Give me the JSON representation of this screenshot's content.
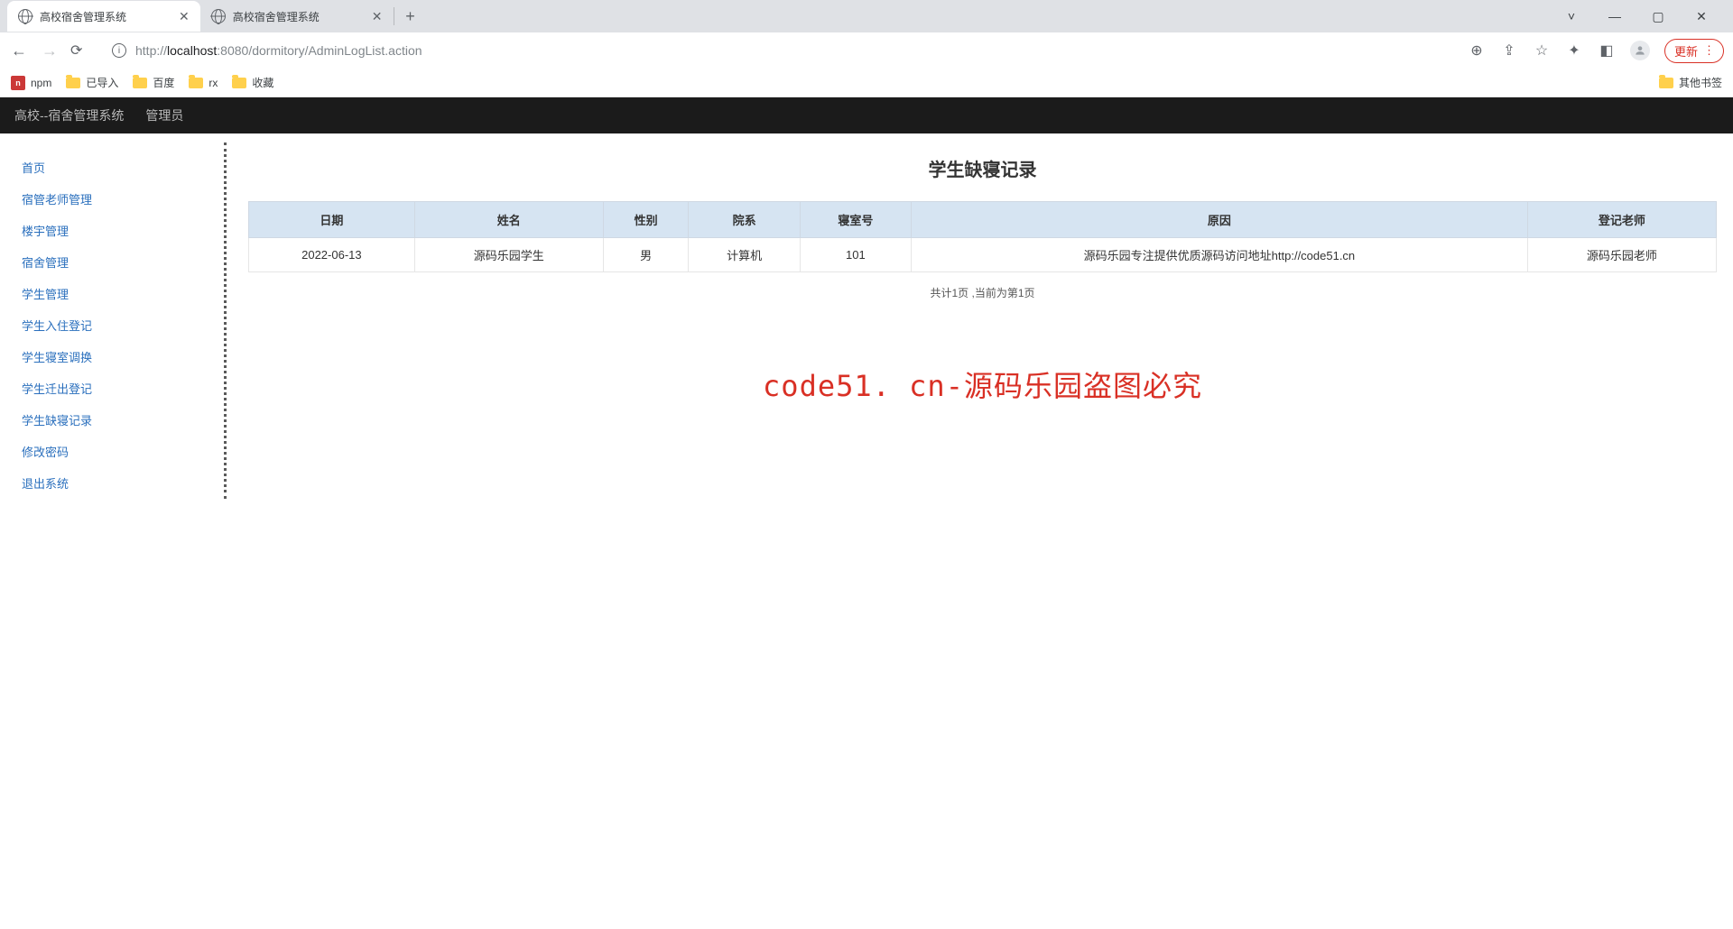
{
  "browser": {
    "tabs": [
      {
        "title": "高校宿舍管理系统",
        "active": true
      },
      {
        "title": "高校宿舍管理系统",
        "active": false
      }
    ],
    "window_controls": {
      "min": "—",
      "max": "▢",
      "close": "✕",
      "dropdown": "˅"
    },
    "url_prefix": "http://",
    "url_host": "localhost",
    "url_port": ":8080",
    "url_path": "/dormitory/AdminLogList.action",
    "update_label": "更新",
    "bookmarks": {
      "items": [
        "npm",
        "已导入",
        "百度",
        "rx",
        "收藏"
      ],
      "other": "其他书签"
    }
  },
  "topbar": {
    "brand": "高校--宿舍管理系统",
    "role": "管理员"
  },
  "sidebar": {
    "items": [
      "首页",
      "宿管老师管理",
      "楼宇管理",
      "宿舍管理",
      "学生管理",
      "学生入住登记",
      "学生寝室调换",
      "学生迁出登记",
      "学生缺寝记录",
      "修改密码",
      "退出系统"
    ]
  },
  "page": {
    "title": "学生缺寝记录",
    "table": {
      "headers": [
        "日期",
        "姓名",
        "性别",
        "院系",
        "寝室号",
        "原因",
        "登记老师"
      ],
      "rows": [
        [
          "2022-06-13",
          "源码乐园学生",
          "男",
          "计算机",
          "101",
          "源码乐园专注提供优质源码访问地址http://code51.cn",
          "源码乐园老师"
        ]
      ]
    },
    "pager": "共计1页 ,当前为第1页",
    "watermark": "code51. cn-源码乐园盗图必究"
  }
}
